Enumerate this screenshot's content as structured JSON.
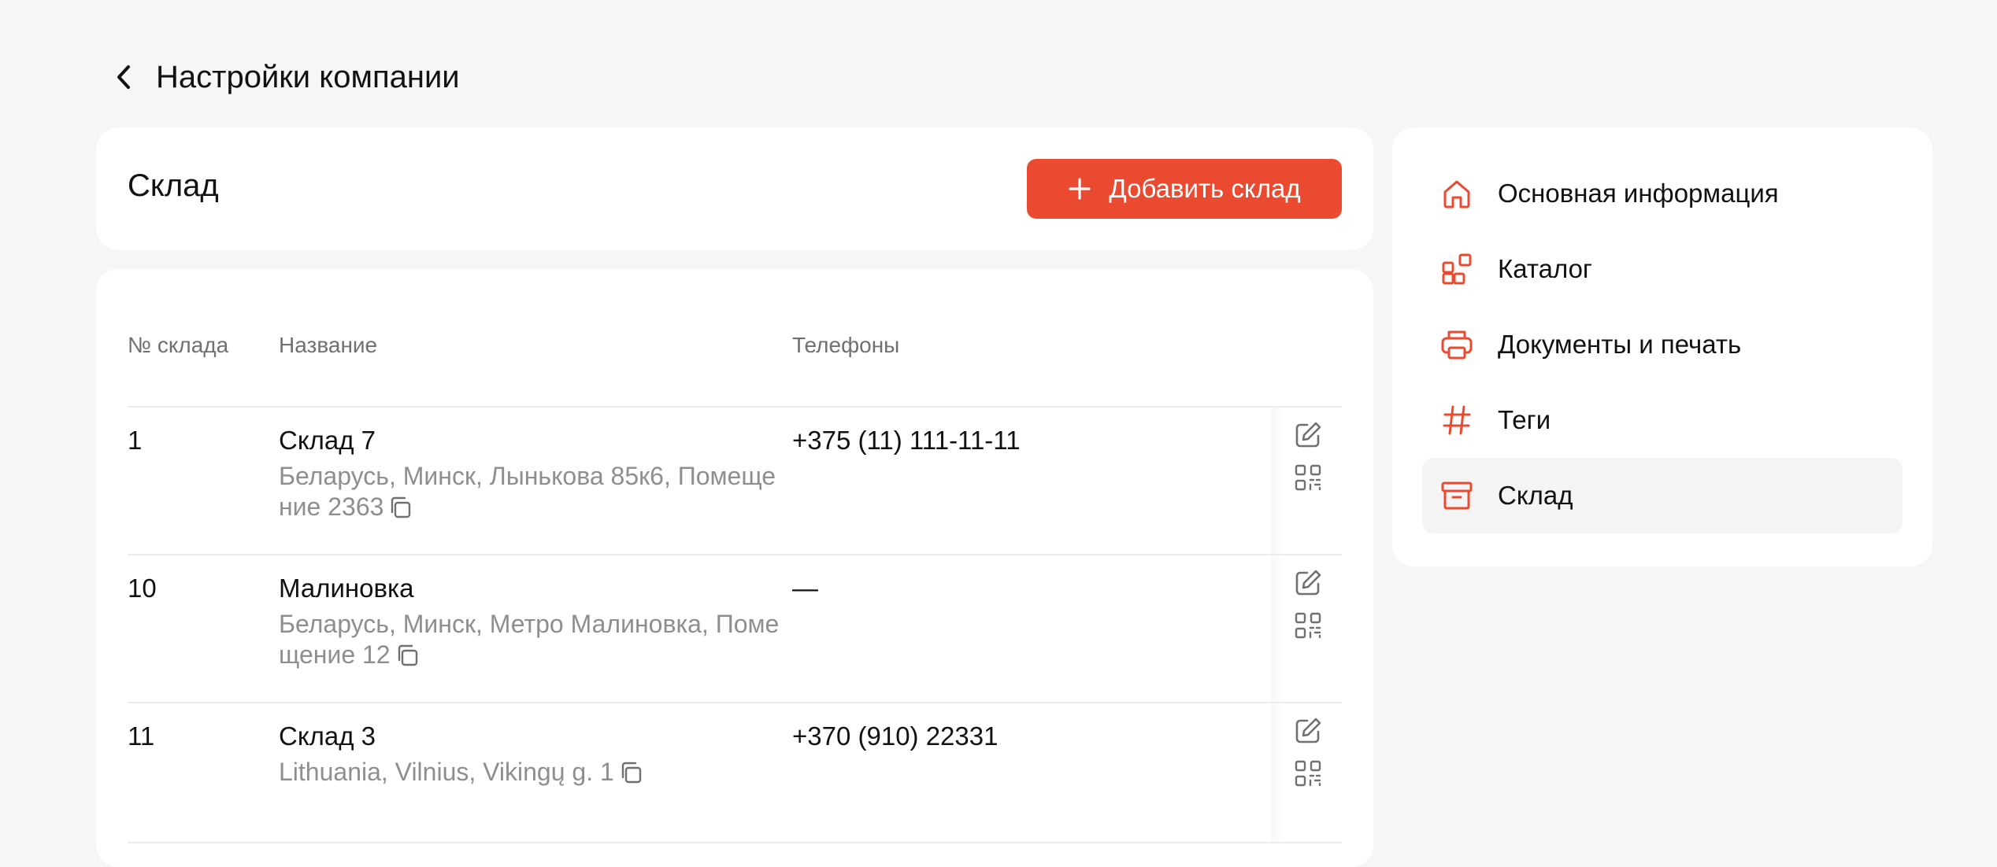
{
  "header": {
    "title": "Настройки компании"
  },
  "section": {
    "title": "Склад",
    "add_label": "Добавить склад"
  },
  "table": {
    "columns": {
      "number": "№ склада",
      "name": "Название",
      "phones": "Телефоны"
    },
    "rows": [
      {
        "number": "1",
        "name": "Склад 7",
        "address": "Беларусь, Минск, Лынькова 85к6, Помещение 2363",
        "phone": "+375 (11) 111-11-11"
      },
      {
        "number": "10",
        "name": "Малиновка",
        "address": "Беларусь, Минск, Метро Малиновка, Помещение 12",
        "phone": "—"
      },
      {
        "number": "11",
        "name": "Склад 3",
        "address": "Lithuania, Vilnius, Vikingų g. 1",
        "phone": "+370 (910) 22331"
      }
    ]
  },
  "menu": {
    "items": [
      {
        "label": "Основная информация",
        "icon": "home-icon"
      },
      {
        "label": "Каталог",
        "icon": "catalog-icon"
      },
      {
        "label": "Документы и печать",
        "icon": "printer-icon"
      },
      {
        "label": "Теги",
        "icon": "hash-icon"
      },
      {
        "label": "Склад",
        "icon": "archive-icon",
        "active": true
      }
    ]
  },
  "colors": {
    "accent": "#ea4a30",
    "background": "#f6f6f6",
    "card": "#ffffff",
    "muted_text": "#8e8e8e"
  }
}
